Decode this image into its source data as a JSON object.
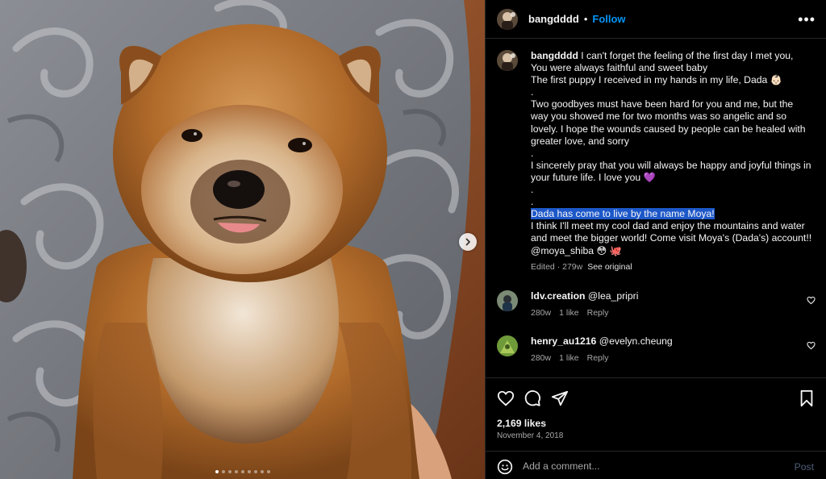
{
  "post": {
    "username": "bangdddd",
    "bullet": "•",
    "follow_label": "Follow",
    "more_label": "•••"
  },
  "caption": {
    "username": "bangdddd",
    "lines": [
      "I can't forget the feeling of the first day I met you,",
      "You were always faithful and sweet baby",
      "The first puppy I received in my hands in my life, Dada 👶🏻",
      ".",
      "Two goodbyes must have been hard for you and me, but the way you showed me for two months was so angelic and so lovely. I hope the wounds caused by people can be healed with greater love, and sorry",
      ".",
      "I sincerely pray that you will always be happy and joyful things in your future life. I love you 💜",
      ".",
      ".",
      "I think I'll meet my cool dad and enjoy the mountains and water and meet the bigger world! Come visit Moya's (Dada's) account!! @moya_shiba 😳 🐙"
    ],
    "highlighted_line": "Dada has come to live by the name Moya!",
    "edited_label": "Edited · 279w",
    "see_original_label": "See original"
  },
  "comments": [
    {
      "username": "ldv.creation",
      "mention": "@lea_pripri",
      "age": "280w",
      "likes": "1 like",
      "reply_label": "Reply"
    },
    {
      "username": "henry_au1216",
      "mention": "@evelyn.cheung",
      "age": "280w",
      "likes": "1 like",
      "reply_label": "Reply"
    }
  ],
  "engagement": {
    "likes_count": "2,169 likes",
    "date": "November 4, 2018"
  },
  "composer": {
    "placeholder": "Add a comment...",
    "post_label": "Post"
  },
  "carousel": {
    "slide_count": 9,
    "active_index": 0
  },
  "icons": {
    "like": "heart-icon",
    "comment": "speech-bubble-icon",
    "share": "paper-plane-icon",
    "save": "bookmark-icon",
    "next": "chevron-right-icon",
    "emoji": "smiley-icon"
  },
  "colors": {
    "background": "#000000",
    "accent": "#0095f6",
    "highlight": "#1d58c9",
    "secondary_text": "#a8a8a8",
    "post_disabled": "#4f5e78"
  }
}
